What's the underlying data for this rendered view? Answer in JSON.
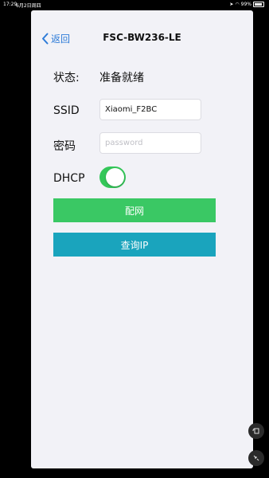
{
  "status_bar": {
    "time": "17:29",
    "date": "6月2日周四",
    "battery": "99%"
  },
  "nav": {
    "back_label": "返回",
    "title": "FSC-BW236-LE"
  },
  "form": {
    "status_label": "状态:",
    "status_value": "准备就绪",
    "ssid_label": "SSID",
    "ssid_value": "Xiaomi_F2BC",
    "password_label": "密码",
    "password_placeholder": "password",
    "dhcp_label": "DHCP",
    "dhcp_enabled": true
  },
  "buttons": {
    "configure": "配网",
    "query_ip": "查询IP"
  },
  "colors": {
    "accent": "#2d7bd8",
    "toggle_on": "#34c759",
    "configure_bg": "#3ac864",
    "query_bg": "#1aa4bd"
  }
}
